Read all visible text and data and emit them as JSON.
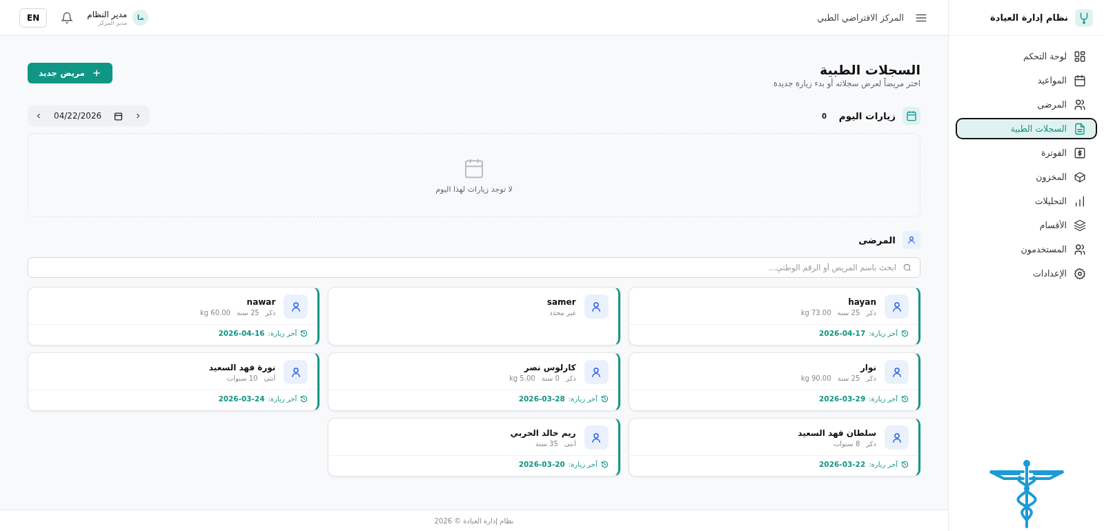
{
  "sidebar": {
    "brand": "نظام إدارة العيادة",
    "items": [
      {
        "label": "لوحة التحكم",
        "selected": false
      },
      {
        "label": "المواعيد",
        "selected": false
      },
      {
        "label": "المرضى",
        "selected": false
      },
      {
        "label": "السجلات الطبية",
        "selected": true
      },
      {
        "label": "الفوترة",
        "selected": false
      },
      {
        "label": "المخزون",
        "selected": false
      },
      {
        "label": "التحليلات",
        "selected": false
      },
      {
        "label": "الأقسام",
        "selected": false
      },
      {
        "label": "المستخدمون",
        "selected": false
      },
      {
        "label": "الإعدادات",
        "selected": false
      }
    ]
  },
  "header": {
    "center_name": "المركز الافتراضي الطبي",
    "language_button": "EN",
    "user": {
      "initials": "ما",
      "name": "مدير النظام",
      "role": "مدير المركز"
    }
  },
  "page": {
    "title": "السجلات الطبية",
    "subtitle": "اختر مريضاً لعرض سجلاته أو بدء زيارة جديدة",
    "new_patient_button": "مريض جديد"
  },
  "today_visits": {
    "title": "زيارات اليوم",
    "count": "0",
    "date": "04/22/2026",
    "empty_message": "لا توجد زيارات لهذا اليوم"
  },
  "patients": {
    "title": "المرضى",
    "search": {
      "placeholder": "ابحث باسم المريض أو الرقم الوطني..."
    },
    "cards": [
      {
        "name": "hayan",
        "details": [
          "ذكر",
          "25 سنة",
          "73.00 kg"
        ],
        "last_visit_label": "آخر زيارة:",
        "last_visit": "2026-04-17"
      },
      {
        "name": "samer",
        "details": [
          "غير محدد"
        ]
      },
      {
        "name": "nawar",
        "details": [
          "ذكر",
          "25 سنة",
          "60.00 kg"
        ],
        "last_visit_label": "آخر زيارة:",
        "last_visit": "2026-04-16"
      },
      {
        "name": "نوار",
        "details": [
          "ذكر",
          "25 سنة",
          "90.00 kg"
        ],
        "last_visit_label": "آخر زيارة:",
        "last_visit": "2026-03-29"
      },
      {
        "name": "كارلوس نصر",
        "details": [
          "ذكر",
          "0 سنة",
          "5.00 kg"
        ],
        "last_visit_label": "آخر زيارة:",
        "last_visit": "2026-03-28"
      },
      {
        "name": "نورة فهد السعيد",
        "details": [
          "أنثى",
          "10 سنوات"
        ],
        "last_visit_label": "آخر زيارة:",
        "last_visit": "2026-03-24"
      },
      {
        "name": "سلطان فهد السعيد",
        "details": [
          "ذكر",
          "8 سنوات"
        ],
        "last_visit_label": "آخر زيارة:",
        "last_visit": "2026-03-22"
      },
      {
        "name": "ريم خالد الحربي",
        "details": [
          "أنثى",
          "35 سنة"
        ],
        "last_visit_label": "آخر زيارة:",
        "last_visit": "2026-03-20"
      }
    ]
  },
  "footer": "نظام إدارة العيادة © 2026"
}
